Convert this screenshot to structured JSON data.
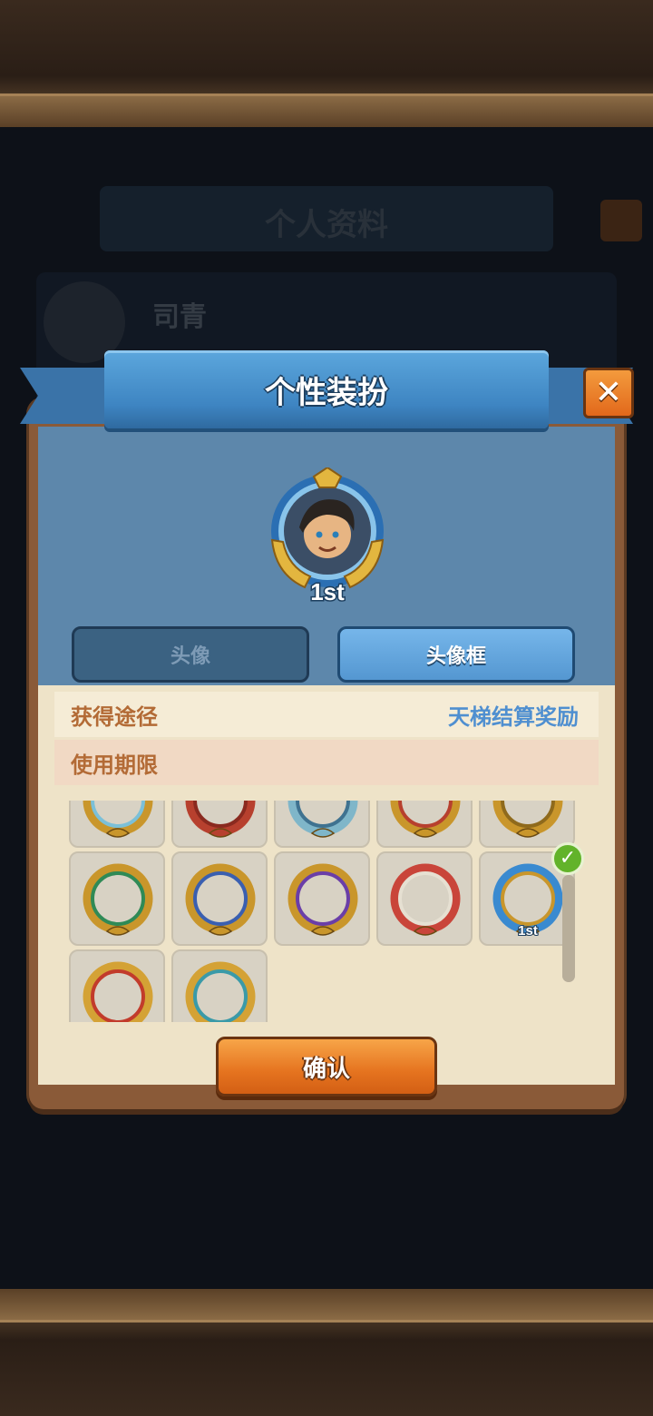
{
  "background": {
    "title": "个人资料",
    "player_name": "司青"
  },
  "dialog": {
    "title": "个性装扮",
    "close_icon": "close-icon",
    "tabs": [
      {
        "label": "头像",
        "selected": false
      },
      {
        "label": "头像框",
        "selected": true
      }
    ],
    "info": {
      "source_label": "获得途径",
      "source_value": "天梯结算奖励",
      "expire_label": "使用期限"
    },
    "big_avatar_badge": "1st",
    "frames": [
      {
        "name": "frame-winged-gold",
        "ring": "#c9962b",
        "accent": "#7bc0d8",
        "selected": false
      },
      {
        "name": "frame-red",
        "ring": "#b7402e",
        "accent": "#8a2a1f",
        "selected": false
      },
      {
        "name": "frame-ice",
        "ring": "#7fb6c9",
        "accent": "#3f7290",
        "selected": false
      },
      {
        "name": "frame-gold-red",
        "ring": "#c9962b",
        "accent": "#b7402e",
        "selected": false
      },
      {
        "name": "frame-gold-plain",
        "ring": "#c9962b",
        "accent": "#8f6a1c",
        "selected": false
      },
      {
        "name": "frame-green",
        "ring": "#c9962b",
        "accent": "#2f8a56",
        "selected": false
      },
      {
        "name": "frame-blue",
        "ring": "#c9962b",
        "accent": "#3a5fb0",
        "selected": false
      },
      {
        "name": "frame-purple",
        "ring": "#c9962b",
        "accent": "#6a3ea8",
        "selected": false
      },
      {
        "name": "frame-horned",
        "ring": "#c9453a",
        "accent": "#e6e0d2",
        "selected": false
      },
      {
        "name": "frame-1st",
        "ring": "#3a8ad0",
        "accent": "#c9962b",
        "badge": "1st",
        "selected": true
      },
      {
        "name": "frame-phoenix",
        "ring": "#d4a235",
        "accent": "#c23b2b",
        "selected": false
      },
      {
        "name": "frame-dragon",
        "ring": "#d4a235",
        "accent": "#3a9aa8",
        "selected": false
      }
    ],
    "confirm_label": "确认"
  },
  "colors": {
    "ribbon": "#3e85c2",
    "confirm": "#e5731f",
    "label": "#b36b36",
    "value": "#4f8fd0"
  }
}
